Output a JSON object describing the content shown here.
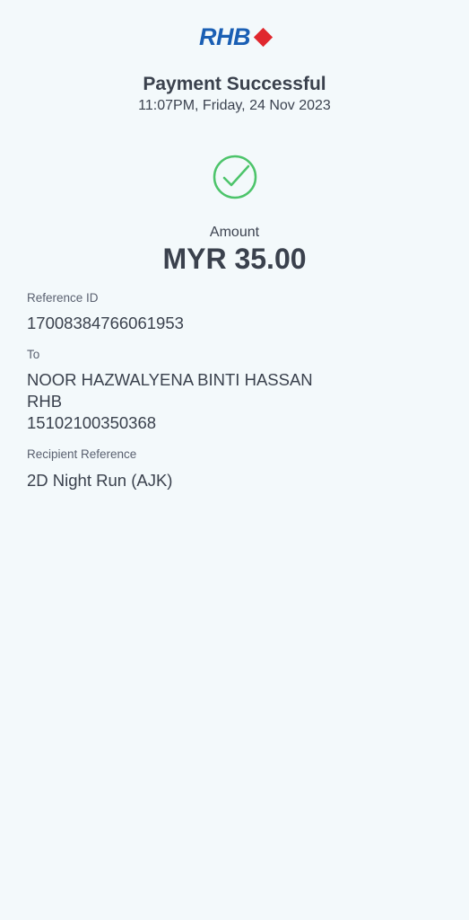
{
  "header": {
    "logo_text": "RHB",
    "title": "Payment Successful",
    "timestamp": "11:07PM, Friday, 24 Nov 2023"
  },
  "status_icon": "check-circle-icon",
  "colors": {
    "background": "#f3f9fb",
    "brand_blue": "#1a5fb4",
    "brand_red": "#e0282e",
    "success_green": "#4cc46a",
    "text_dark": "#3a414d"
  },
  "amount": {
    "label": "Amount",
    "value": "MYR 35.00"
  },
  "details": {
    "reference_id": {
      "label": "Reference ID",
      "value": "17008384766061953"
    },
    "to": {
      "label": "To",
      "name": "NOOR HAZWALYENA BINTI HASSAN",
      "bank": "RHB",
      "account": "15102100350368"
    },
    "recipient_reference": {
      "label": "Recipient Reference",
      "value": "2D Night Run (AJK)"
    }
  }
}
